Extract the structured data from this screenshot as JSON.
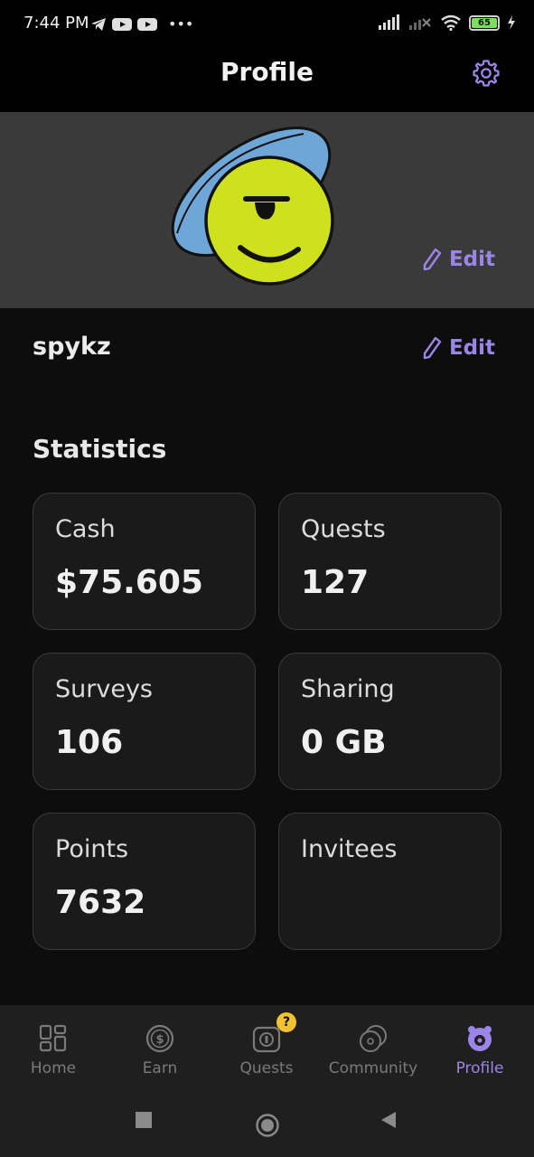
{
  "status_bar": {
    "time": "7:44 PM",
    "battery": "65"
  },
  "header": {
    "title": "Profile",
    "settings_icon": "gear-icon"
  },
  "banner": {
    "edit_label": "Edit"
  },
  "profile": {
    "username": "spykz",
    "edit_label": "Edit"
  },
  "statistics": {
    "title": "Statistics",
    "cards": [
      {
        "label": "Cash",
        "value": "$75.605"
      },
      {
        "label": "Quests",
        "value": "127"
      },
      {
        "label": "Surveys",
        "value": "106"
      },
      {
        "label": "Sharing",
        "value": "0 GB"
      },
      {
        "label": "Points",
        "value": "7632"
      },
      {
        "label": "Invitees",
        "value": ""
      }
    ]
  },
  "bottom_nav": {
    "items": [
      {
        "label": "Home",
        "icon": "grid-icon"
      },
      {
        "label": "Earn",
        "icon": "dollar-coin-icon"
      },
      {
        "label": "Quests",
        "icon": "quest-icon",
        "badge": "?"
      },
      {
        "label": "Community",
        "icon": "community-coins-icon"
      },
      {
        "label": "Profile",
        "icon": "profile-icon"
      }
    ]
  },
  "colors": {
    "accent": "#9b86e8",
    "background": "#0d0d0d",
    "card": "#1a1a1a",
    "banner": "#3a3a3a",
    "badge": "#f2c230"
  }
}
